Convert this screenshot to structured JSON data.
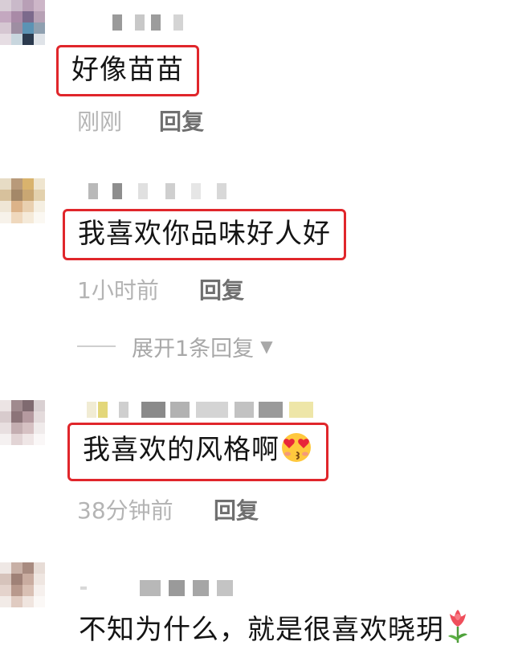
{
  "comments": [
    {
      "text": "好像苗苗",
      "time": "刚刚",
      "reply_label": "回复"
    },
    {
      "text": "我喜欢你品味好人好",
      "time": "1小时前",
      "reply_label": "回复",
      "expand_label": "展开1条回复"
    },
    {
      "text": "我喜欢的风格啊",
      "emoji": "heart-eyes-kiss-emoji",
      "time": "38分钟前",
      "reply_label": "回复"
    },
    {
      "text": "不知为什么，就是很喜欢晓玥",
      "emoji": "tulip-emoji"
    }
  ],
  "colors": {
    "highlight_box": "#e0262b",
    "meta_text": "#b4b4b4",
    "reply_text": "#6f6f6f"
  }
}
